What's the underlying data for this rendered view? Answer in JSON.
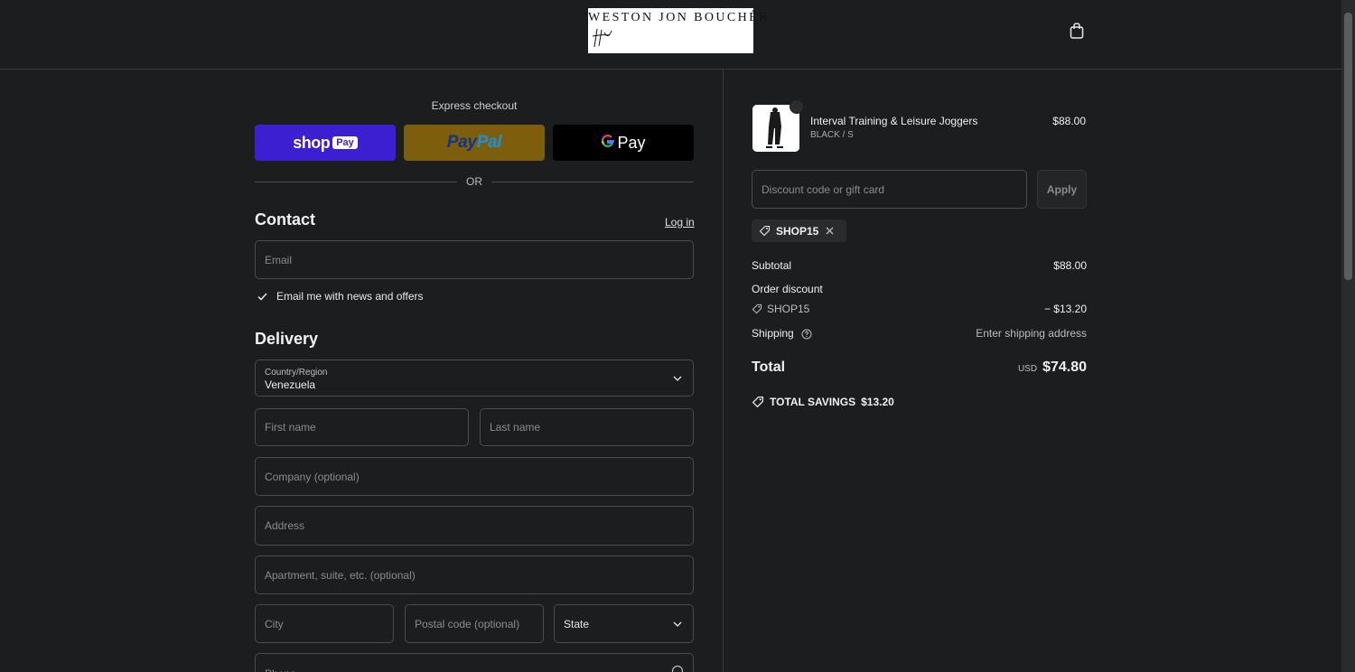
{
  "header": {
    "brand_name": "WESTON JON BOUCHÉR",
    "cart_icon": "shopping-bag-icon"
  },
  "express": {
    "title": "Express checkout",
    "shop_pay_label": "shop",
    "shop_pay_badge": "Pay",
    "paypal_label_a": "Pay",
    "paypal_label_b": "Pal",
    "gpay_g": "G",
    "gpay_label": "Pay",
    "or_label": "OR"
  },
  "contact": {
    "title": "Contact",
    "login_label": "Log in",
    "email_placeholder": "Email",
    "newsletter_label": "Email me with news and offers",
    "newsletter_checked": true
  },
  "delivery": {
    "title": "Delivery",
    "country_label": "Country/Region",
    "country_value": "Venezuela",
    "first_name_placeholder": "First name",
    "last_name_placeholder": "Last name",
    "company_placeholder": "Company (optional)",
    "address_placeholder": "Address",
    "apartment_placeholder": "Apartment, suite, etc. (optional)",
    "city_placeholder": "City",
    "postal_placeholder": "Postal code (optional)",
    "state_value": "State",
    "phone_placeholder": "Phone"
  },
  "order": {
    "item_name": "Interval Training & Leisure Joggers",
    "item_variant": "BLACK / S",
    "item_price": "$88.00",
    "discount_placeholder": "Discount code or gift card",
    "apply_label": "Apply",
    "applied_code": "SHOP15",
    "subtotal_label": "Subtotal",
    "subtotal_value": "$88.00",
    "order_discount_label": "Order discount",
    "discount_code": "SHOP15",
    "discount_value": "− $13.20",
    "shipping_label": "Shipping",
    "shipping_value": "Enter shipping address",
    "total_label": "Total",
    "currency": "USD",
    "total_value": "$74.80",
    "savings_label": "TOTAL SAVINGS",
    "savings_value": "$13.20"
  },
  "colors": {
    "background": "#1c1d1f",
    "shop_pay": "#3b1fd0",
    "paypal": "#7d5e0c",
    "gpay": "#000000",
    "border": "#4a4b4d"
  }
}
